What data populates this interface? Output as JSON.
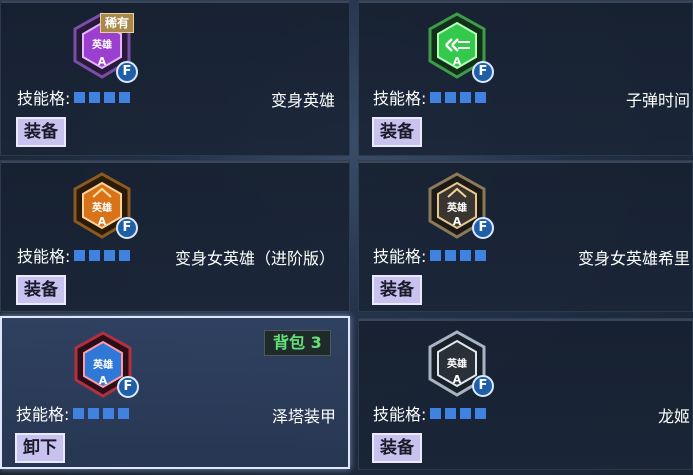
{
  "slot_label": "技能格:",
  "cards": [
    {
      "name": "变身英雄",
      "button": "装备",
      "rare_tag": "稀有",
      "icon_text": "英雄",
      "grade": "A",
      "hotkey": "F",
      "theme": "purple"
    },
    {
      "name": "子弹时间",
      "button": "装备",
      "icon_text": "",
      "grade": "A",
      "hotkey": "F",
      "theme": "green"
    },
    {
      "name": "变身女英雄（进阶版）",
      "button": "装备",
      "icon_text": "英雄",
      "grade": "A",
      "hotkey": "F",
      "theme": "orange"
    },
    {
      "name": "变身女英雄希里",
      "button": "装备",
      "icon_text": "英雄",
      "grade": "A",
      "hotkey": "F",
      "theme": "gold"
    },
    {
      "name": "泽塔装甲",
      "button": "卸下",
      "bag_tag": "背包 3",
      "icon_text": "英雄",
      "grade": "A",
      "hotkey": "F",
      "theme": "red"
    },
    {
      "name": "龙姬",
      "button": "装备",
      "icon_text": "英雄",
      "grade": "A",
      "hotkey": "F",
      "theme": "silver"
    }
  ]
}
